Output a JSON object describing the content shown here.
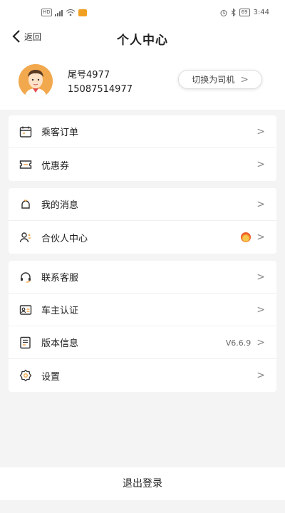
{
  "status_bar": {
    "time": "3:44",
    "battery": "69"
  },
  "header": {
    "back_label": "返回",
    "title": "个人中心"
  },
  "profile": {
    "name": "尾号4977",
    "phone": "15087514977",
    "switch_label": "切换为司机"
  },
  "groups": [
    {
      "items": [
        {
          "label": "乘客订单",
          "icon": "calendar-icon",
          "value": ""
        },
        {
          "label": "优惠券",
          "icon": "ticket-icon",
          "value": ""
        }
      ]
    },
    {
      "items": [
        {
          "label": "我的消息",
          "icon": "bell-icon",
          "value": ""
        },
        {
          "label": "合伙人中心",
          "icon": "partner-icon",
          "value": "",
          "badge": "flame-icon"
        }
      ]
    },
    {
      "items": [
        {
          "label": "联系客服",
          "icon": "headset-icon",
          "value": ""
        },
        {
          "label": "车主认证",
          "icon": "id-card-icon",
          "value": ""
        },
        {
          "label": "版本信息",
          "icon": "info-doc-icon",
          "value": "V6.6.9"
        },
        {
          "label": "设置",
          "icon": "gear-icon",
          "value": ""
        }
      ]
    }
  ],
  "logout_label": "退出登录",
  "colors": {
    "accent_orange": "#f2a94e",
    "background": "#f4f4f4"
  }
}
